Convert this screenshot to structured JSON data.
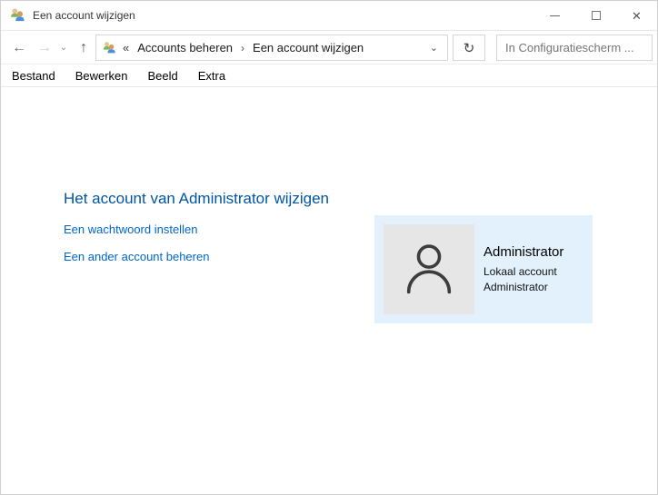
{
  "window": {
    "title": "Een account wijzigen",
    "icons": {
      "close": "✕"
    }
  },
  "toolbar": {
    "icons": {
      "back": "←",
      "forward": "→",
      "history_chevron": "⌄",
      "up": "↑",
      "breadcrumb_overflow": "«",
      "breadcrumb_separator": "›",
      "address_chevron": "⌄",
      "refresh": "↻"
    },
    "breadcrumb": [
      "Accounts beheren",
      "Een account wijzigen"
    ],
    "search": {
      "placeholder": "In Configuratiescherm ..."
    }
  },
  "menubar": {
    "items": [
      "Bestand",
      "Bewerken",
      "Beeld",
      "Extra"
    ]
  },
  "content": {
    "heading": "Het account van Administrator wijzigen",
    "links": [
      "Een wachtwoord instellen",
      "Een ander account beheren"
    ],
    "account_tile": {
      "name": "Administrator",
      "account_type": "Lokaal account",
      "role": "Administrator"
    }
  },
  "colors": {
    "heading_blue": "#0055A4",
    "link_blue": "#0066CC",
    "tile_background": "#E2F1FB",
    "avatar_background": "#E6E6E6"
  }
}
